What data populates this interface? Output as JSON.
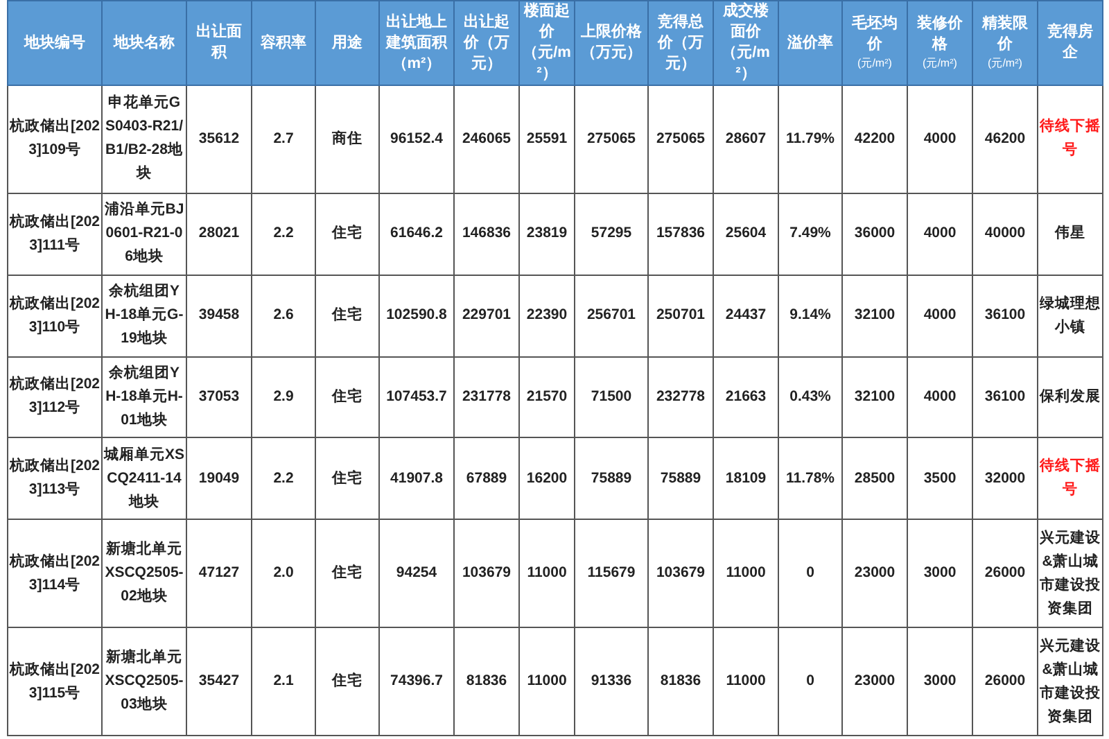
{
  "table": {
    "columns": [
      {
        "label": "地块编号"
      },
      {
        "label": "地块名称"
      },
      {
        "label": "出让面积"
      },
      {
        "label": "容积率"
      },
      {
        "label": "用途"
      },
      {
        "label": "出让地上建筑面积（m²）"
      },
      {
        "label": "出让起价（万元）"
      },
      {
        "label": "楼面起价（元/m²）"
      },
      {
        "label": "上限价格（万元）"
      },
      {
        "label": "竞得总价（万元）"
      },
      {
        "label": "成交楼面价（元/m²）"
      },
      {
        "label": "溢价率"
      },
      {
        "label": "毛坯均价",
        "unit": "(元/m²)"
      },
      {
        "label": "装修价格",
        "unit": "(元/m²)"
      },
      {
        "label": "精装限价",
        "unit": "(元/m²)"
      },
      {
        "label": "竞得房企"
      }
    ],
    "rows": [
      {
        "cells": [
          "杭政储出[2023]109号",
          "申花单元GS0403-R21/B1/B2-28地块",
          "35612",
          "2.7",
          "商住",
          "96152.4",
          "246065",
          "25591",
          "275065",
          "275065",
          "28607",
          "11.79%",
          "42200",
          "4000",
          "46200"
        ],
        "winner": "待线下摇号",
        "alert": true
      },
      {
        "cells": [
          "杭政储出[2023]111号",
          "浦沿单元BJ0601-R21-06地块",
          "28021",
          "2.2",
          "住宅",
          "61646.2",
          "146836",
          "23819",
          "57295",
          "157836",
          "25604",
          "7.49%",
          "36000",
          "4000",
          "40000"
        ],
        "winner": "伟星",
        "alert": false
      },
      {
        "cells": [
          "杭政储出[2023]110号",
          "余杭组团YH-18单元G-19地块",
          "39458",
          "2.6",
          "住宅",
          "102590.8",
          "229701",
          "22390",
          "256701",
          "250701",
          "24437",
          "9.14%",
          "32100",
          "4000",
          "36100"
        ],
        "winner": "绿城理想小镇",
        "alert": false
      },
      {
        "cells": [
          "杭政储出[2023]112号",
          "余杭组团YH-18单元H-01地块",
          "37053",
          "2.9",
          "住宅",
          "107453.7",
          "231778",
          "21570",
          "71500",
          "232778",
          "21663",
          "0.43%",
          "32100",
          "4000",
          "36100"
        ],
        "winner": "保利发展",
        "alert": false
      },
      {
        "cells": [
          "杭政储出[2023]113号",
          "城厢单元XSCQ2411-14地块",
          "19049",
          "2.2",
          "住宅",
          "41907.8",
          "67889",
          "16200",
          "75889",
          "75889",
          "18109",
          "11.78%",
          "28500",
          "3500",
          "32000"
        ],
        "winner": "待线下摇号",
        "alert": true
      },
      {
        "cells": [
          "杭政储出[2023]114号",
          "新塘北单元XSCQ2505-02地块",
          "47127",
          "2.0",
          "住宅",
          "94254",
          "103679",
          "11000",
          "115679",
          "103679",
          "11000",
          "0",
          "23000",
          "3000",
          "26000"
        ],
        "winner": "兴元建设&萧山城市建设投资集团",
        "alert": false
      },
      {
        "cells": [
          "杭政储出[2023]115号",
          "新塘北单元XSCQ2505-03地块",
          "35427",
          "2.1",
          "住宅",
          "74396.7",
          "81836",
          "11000",
          "91336",
          "81836",
          "11000",
          "0",
          "23000",
          "3000",
          "26000"
        ],
        "winner": "兴元建设&萧山城市建设投资集团",
        "alert": false
      }
    ]
  }
}
